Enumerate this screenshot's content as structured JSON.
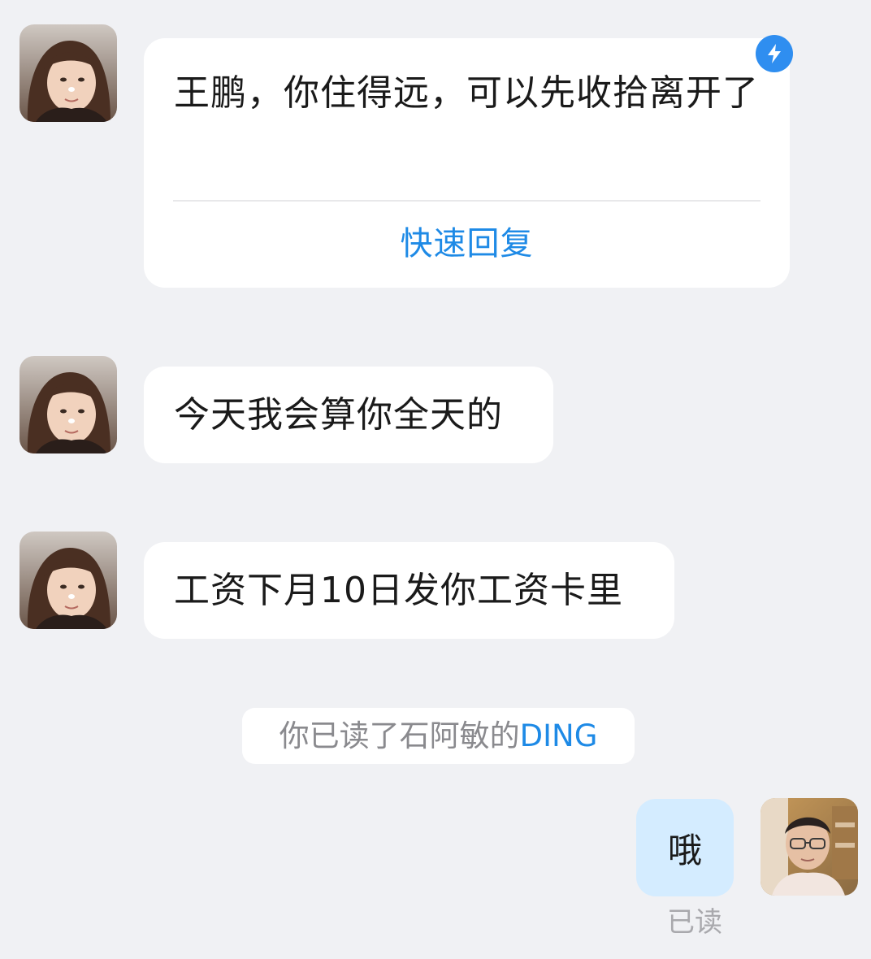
{
  "conversation": {
    "messages": [
      {
        "sender": "incoming",
        "type": "ding",
        "text": "王鹏，你住得远，可以先收拾离开了",
        "quick_reply_label": "快速回复"
      },
      {
        "sender": "incoming",
        "type": "text",
        "text": "今天我会算你全天的"
      },
      {
        "sender": "incoming",
        "type": "text",
        "text": "工资下月10日发你工资卡里"
      }
    ],
    "system_notice": {
      "prefix": "你已读了石阿敏的",
      "link": "DING"
    },
    "outgoing": {
      "text": "哦",
      "status": "已读"
    }
  },
  "icons": {
    "ding_badge": "lightning-icon",
    "incoming_avatar": "user-avatar-female",
    "outgoing_avatar": "user-avatar-male"
  },
  "colors": {
    "background": "#f0f1f4",
    "accent": "#1e8ae6",
    "outgoing_bubble": "#d4ecff",
    "badge": "#2f8ef0"
  }
}
